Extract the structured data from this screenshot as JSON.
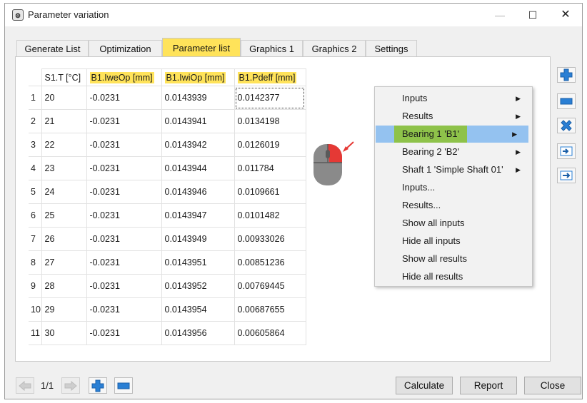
{
  "window": {
    "title": "Parameter variation",
    "icon": "parameter-variation-app-icon"
  },
  "tabs": [
    {
      "label": "Generate List",
      "active": false
    },
    {
      "label": "Optimization",
      "active": false
    },
    {
      "label": "Parameter list",
      "active": true
    },
    {
      "label": "Graphics 1",
      "active": false
    },
    {
      "label": "Graphics 2",
      "active": false
    },
    {
      "label": "Settings",
      "active": false
    }
  ],
  "table": {
    "headers": [
      "S1.T [°C]",
      "B1.IweOp [mm]",
      "B1.IwiOp [mm]",
      "B1.Pdeff [mm]"
    ],
    "highlight_color": "#ffe35a",
    "rows": [
      {
        "n": "1",
        "cells": [
          "20",
          "-0.0231",
          "0.0143939",
          "0.0142377"
        ]
      },
      {
        "n": "2",
        "cells": [
          "21",
          "-0.0231",
          "0.0143941",
          "0.0134198"
        ]
      },
      {
        "n": "3",
        "cells": [
          "22",
          "-0.0231",
          "0.0143942",
          "0.0126019"
        ]
      },
      {
        "n": "4",
        "cells": [
          "23",
          "-0.0231",
          "0.0143944",
          "0.011784"
        ]
      },
      {
        "n": "5",
        "cells": [
          "24",
          "-0.0231",
          "0.0143946",
          "0.0109661"
        ]
      },
      {
        "n": "6",
        "cells": [
          "25",
          "-0.0231",
          "0.0143947",
          "0.0101482"
        ]
      },
      {
        "n": "7",
        "cells": [
          "26",
          "-0.0231",
          "0.0143949",
          "0.00933026"
        ]
      },
      {
        "n": "8",
        "cells": [
          "27",
          "-0.0231",
          "0.0143951",
          "0.00851236"
        ]
      },
      {
        "n": "9",
        "cells": [
          "28",
          "-0.0231",
          "0.0143952",
          "0.00769445"
        ]
      },
      {
        "n": "10",
        "cells": [
          "29",
          "-0.0231",
          "0.0143954",
          "0.00687655"
        ]
      },
      {
        "n": "11",
        "cells": [
          "30",
          "-0.0231",
          "0.0143956",
          "0.00605864"
        ]
      }
    ]
  },
  "context_menu": {
    "items": [
      {
        "label": "Inputs",
        "submenu": true
      },
      {
        "label": "Results",
        "submenu": true
      },
      {
        "label": "Bearing 1 'B1'",
        "submenu": true,
        "highlighted": true
      },
      {
        "label": "Bearing 2 'B2'",
        "submenu": true
      },
      {
        "label": "Shaft 1 'Simple Shaft 01'",
        "submenu": true
      },
      {
        "label": "Inputs...",
        "submenu": false
      },
      {
        "label": "Results...",
        "submenu": false
      },
      {
        "label": "Show all inputs",
        "submenu": false
      },
      {
        "label": "Hide all inputs",
        "submenu": false
      },
      {
        "label": "Show all results",
        "submenu": false
      },
      {
        "label": "Hide all results",
        "submenu": false
      }
    ],
    "highlight_color": "#94c2f0",
    "highlight_label_color": "#8ec24a"
  },
  "side_buttons": [
    "add-icon",
    "remove-icon",
    "delete-icon",
    "import-icon",
    "export-icon"
  ],
  "footer": {
    "page": "1/1",
    "calculate_label": "Calculate",
    "report_label": "Report",
    "close_label": "Close"
  },
  "colors": {
    "accent_blue": "#1e73c8",
    "tab_active": "#ffe35a",
    "mouse_button": "#e53935"
  }
}
